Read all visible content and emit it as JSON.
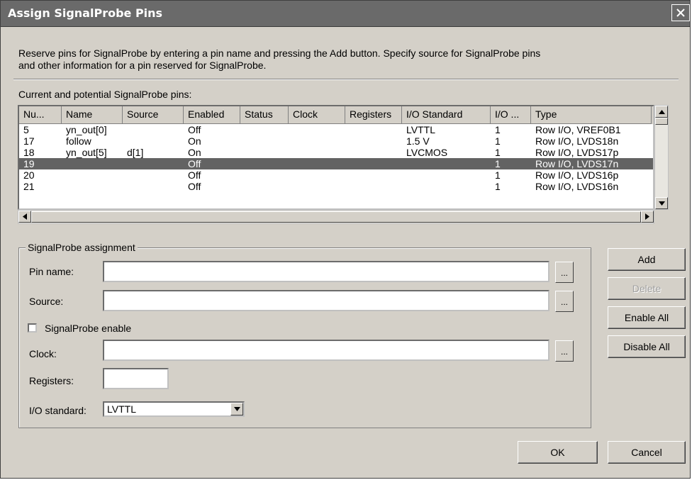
{
  "window": {
    "title": "Assign SignalProbe Pins",
    "close_symbol": "✕"
  },
  "description": "Reserve pins for SignalProbe by entering a pin name and pressing the Add button. Specify source for SignalProbe pins and other information for a pin reserved for SignalProbe.",
  "table_label": "Current and potential SignalProbe pins:",
  "table": {
    "columns": [
      "Nu...",
      "Name",
      "Source",
      "Enabled",
      "Status",
      "Clock",
      "Registers",
      "I/O Standard",
      "I/O ...",
      "Type"
    ],
    "rows": [
      [
        "5",
        "yn_out[0]",
        "",
        "Off",
        "",
        "",
        "",
        "LVTTL",
        "1",
        "Row I/O, VREF0B1"
      ],
      [
        "17",
        "follow",
        "",
        "On",
        "",
        "",
        "",
        "1.5 V",
        "1",
        "Row I/O, LVDS18n"
      ],
      [
        "18",
        "yn_out[5]",
        "d[1]",
        "On",
        "",
        "",
        "",
        "LVCMOS",
        "1",
        "Row I/O, LVDS17p"
      ],
      [
        "19",
        "",
        "",
        "Off",
        "",
        "",
        "",
        "",
        "1",
        "Row I/O, LVDS17n"
      ],
      [
        "20",
        "",
        "",
        "Off",
        "",
        "",
        "",
        "",
        "1",
        "Row I/O, LVDS16p"
      ],
      [
        "21",
        "",
        "",
        "Off",
        "",
        "",
        "",
        "",
        "1",
        "Row I/O, LVDS16n"
      ]
    ],
    "selected_row": 3
  },
  "assignment": {
    "group_label": "SignalProbe assignment",
    "pin_name_label": "Pin name:",
    "pin_name_value": "",
    "source_label": "Source:",
    "source_value": "",
    "enable_label": "SignalProbe enable",
    "enable_checked": false,
    "clock_label": "Clock:",
    "clock_value": "",
    "registers_label": "Registers:",
    "registers_value": "",
    "io_standard_label": "I/O standard:",
    "io_standard_value": "LVTTL",
    "browse_label": "..."
  },
  "buttons": {
    "add": "Add",
    "delete": "Delete",
    "enable_all": "Enable All",
    "disable_all": "Disable All",
    "ok": "OK",
    "cancel": "Cancel"
  },
  "colors": {
    "dialog_bg": "#d4d0c8",
    "titlebar": "#6a6a6a",
    "selection": "#636363"
  }
}
